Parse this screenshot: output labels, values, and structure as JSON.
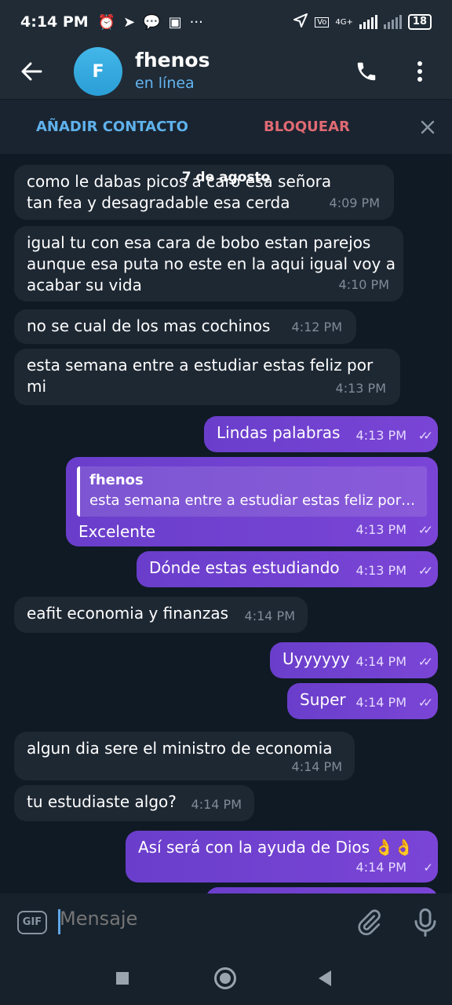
{
  "status_bar": {
    "time": "4:14 PM",
    "extra": "···",
    "network": "4G+",
    "battery": "18"
  },
  "header": {
    "avatar_letter": "F",
    "name": "fhenos",
    "status": "en línea"
  },
  "action_bar": {
    "add_contact": "AÑADIR CONTACTO",
    "block": "BLOQUEAR"
  },
  "date_label": "7 de agosto",
  "messages": [
    {
      "direction": "in",
      "text": "como le dabas picos a caro esa señora tan fea y desagradable esa cerda",
      "time": "4:09 PM"
    },
    {
      "direction": "in",
      "text": "igual tu con esa cara de bobo estan parejos aunque esa puta no este en la aqui igual voy a acabar su vida",
      "time": "4:10 PM"
    },
    {
      "direction": "in",
      "text": "no se cual de los mas cochinos",
      "time": "4:12 PM"
    },
    {
      "direction": "in",
      "text": "esta semana entre a estudiar estas feliz por mi",
      "time": "4:13 PM"
    },
    {
      "direction": "out",
      "text": "Lindas palabras",
      "time": "4:13 PM",
      "status": "read"
    },
    {
      "direction": "out",
      "text": "Excelente",
      "time": "4:13 PM",
      "status": "read",
      "reply_to": {
        "name": "fhenos",
        "text": "esta semana entre a estudiar estas feliz por…"
      }
    },
    {
      "direction": "out",
      "text": "Dónde estas estudiando",
      "time": "4:13 PM",
      "status": "read"
    },
    {
      "direction": "in",
      "text": "eafit economia y finanzas",
      "time": "4:14 PM"
    },
    {
      "direction": "out",
      "text": "Uyyyyyy",
      "time": "4:14 PM",
      "status": "read"
    },
    {
      "direction": "out",
      "text": "Super",
      "time": "4:14 PM",
      "status": "read"
    },
    {
      "direction": "in",
      "text": "algun dia sere el ministro de economia",
      "time": "4:14 PM"
    },
    {
      "direction": "in",
      "text": "tu estudiaste algo?",
      "time": "4:14 PM"
    },
    {
      "direction": "out",
      "text": "Así será con la ayuda de Dios 👌👌",
      "time": "4:14 PM",
      "status": "sent"
    }
  ],
  "input": {
    "placeholder": "Mensaje",
    "gif_label": "GIF"
  },
  "colors": {
    "accent_blue": "#5fb2ec",
    "danger_red": "#e06a73",
    "outgoing_bubble": "#7243d0",
    "incoming_bubble": "#1e2833"
  }
}
